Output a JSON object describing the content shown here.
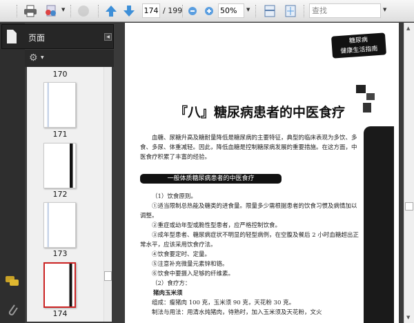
{
  "toolbar": {
    "page_current": "174",
    "page_total": "/ 199",
    "zoom": "50%",
    "find_placeholder": "查找"
  },
  "sidebar": {
    "panel_title": "页面",
    "thumbnails": [
      {
        "label": "170"
      },
      {
        "label": "171"
      },
      {
        "label": "172"
      },
      {
        "label": "173"
      },
      {
        "label": "174",
        "selected": true
      }
    ]
  },
  "document": {
    "header_logo_line1": "糖尿病",
    "header_logo_line2": "健康生活指南",
    "title": "『八』糖尿病患者的中医食疗",
    "intro": "血糖、尿糖升高及糖耐量降低是糖尿病的主要特征，典型的临床表现为多饮、多食、多尿、体重减轻。因此，降低血糖是控制糖尿病发展的重要措施。在这方面，中医食疗积累了丰富的经验。",
    "section_banner": "一般体质糖尿病患者的中医食疗",
    "lines": [
      "（1）饮食原则。",
      "①适当限制总热能及糖类的进食量。限量多少需根据患者的饮食习惯及病情加以调整。",
      "②重症或幼年型或脆性型患者，应严格控制饮食。",
      "③成年型患者、糖尿病症状不明显的轻型病例，在空腹及餐后 2 小时血糖超出正常水平，应该采用饮食疗法。",
      "④饮食要定时、定量。",
      "⑤注意补充微量元素锌和铬。",
      "⑥饮食中要摄入足够的纤维素。",
      "（2）食疗方："
    ],
    "recipe_title": "猪肉玉米须",
    "recipe_ingredients": "组成：瘦猪肉 100 克，玉米须 90 克，天花粉 30 克。",
    "recipe_method": "制法与用法：用清水炖猪肉，待熟时，加入玉米须及天花粉，文火"
  },
  "colors": {
    "selected_thumb": "#cc2222",
    "toolbar_bg": "#e8e8e8",
    "panel_bg": "#2e2e2e"
  }
}
